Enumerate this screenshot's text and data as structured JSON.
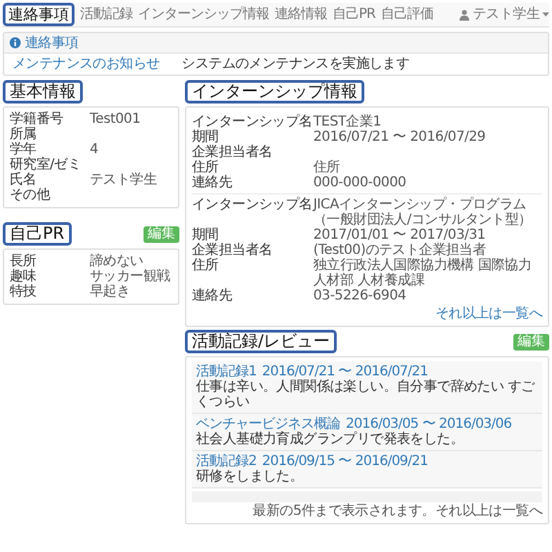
{
  "header": {
    "callout": "連絡事項",
    "nav": [
      "活動記録",
      "インターンシップ情報",
      "連絡情報",
      "自己PR",
      "自己評価"
    ],
    "user": "テスト学生"
  },
  "notice": {
    "title": "連絡事項",
    "rows": [
      {
        "subject": "メンテナンスのお知らせ",
        "body": "システムのメンテナンスを実施します"
      }
    ]
  },
  "basic_info": {
    "callout": "基本情報",
    "fields": [
      {
        "label": "学籍番号",
        "value": "Test001"
      },
      {
        "label": "所属"
      },
      {
        "label": "学年",
        "value": "4"
      },
      {
        "label": "研究室/ゼミ"
      },
      {
        "label": "氏名",
        "value": "テスト学生"
      },
      {
        "label": "その他"
      }
    ]
  },
  "self_pr": {
    "callout": "自己PR",
    "edit_button": "編集",
    "fields": [
      {
        "label": "長所",
        "value": "諦めない"
      },
      {
        "label": "趣味",
        "value": "サッカー観戦"
      },
      {
        "label": "特技",
        "value": "早起き"
      }
    ]
  },
  "internship": {
    "callout": "インターンシップ情報",
    "groups": [
      [
        {
          "label": "インターンシップ名",
          "value": "TEST企業1"
        },
        {
          "label": "期間",
          "value": "2016/07/21 〜 2016/07/29"
        },
        {
          "label": "企業担当者名"
        },
        {
          "label": "住所",
          "value": "住所"
        },
        {
          "label": "連絡先",
          "value": "000-000-0000"
        }
      ],
      [
        {
          "label": "インターンシップ名",
          "value": "JICAインターンシップ・プログラム（一般財団法人/コンサルタント型）"
        },
        {
          "label": "期間",
          "value": "2017/01/01 〜 2017/03/31"
        },
        {
          "label": "企業担当者名",
          "value": "(Test00)のテスト企業担当者"
        },
        {
          "label": "住所",
          "value": "独立行政法人国際協力機構 国際協力人材部 人材養成課"
        },
        {
          "label": "連絡先",
          "value": "03-5226-6904"
        }
      ]
    ],
    "more_link": "それ以上は一覧へ"
  },
  "activity": {
    "callout": "活動記録/レビュー",
    "edit_button": "編集",
    "entries": [
      {
        "title": "活動記録1",
        "period": "2016/07/21 〜 2016/07/21",
        "text": "仕事は辛い。人間関係は楽しい。自分事で辞めたい すごくつらい"
      },
      {
        "title": "ベンチャービジネス概論",
        "period": "2016/03/05 〜 2016/03/06",
        "text": "社会人基礎力育成グランプリで発表をした。"
      },
      {
        "title": "活動記録2",
        "period": "2016/09/15 〜 2016/09/21",
        "text": "研修をしました。"
      }
    ],
    "footer": "最新の5件まで表示されます。それ以上は一覧へ"
  }
}
